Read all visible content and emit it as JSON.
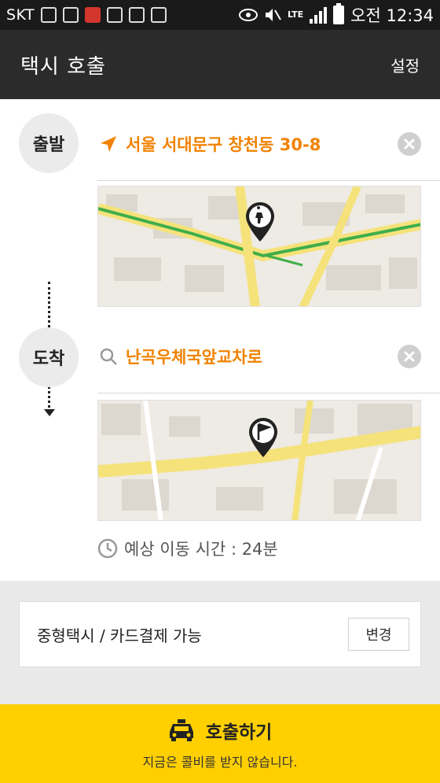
{
  "status_bar": {
    "carrier": "SKT",
    "network": "LTE",
    "time": "오전 12:34"
  },
  "app_bar": {
    "title": "택시 호출",
    "settings_label": "설정"
  },
  "departure": {
    "badge": "출발",
    "address": "서울 서대문구 창천동 30-8",
    "icon": "navigation-arrow-icon"
  },
  "arrival": {
    "badge": "도착",
    "address": "난곡우체국앞교차로",
    "icon": "search-icon"
  },
  "eta": {
    "text": "예상 이동 시간 : 24분"
  },
  "option": {
    "text": "중형택시 / 카드결제 가능",
    "change_label": "변경"
  },
  "call": {
    "label": "호출하기",
    "note": "지금은 콜비를 받지 않습니다."
  },
  "colors": {
    "accent": "#f08200",
    "callbar": "#ffcf00",
    "appbar": "#2b2b2b"
  }
}
